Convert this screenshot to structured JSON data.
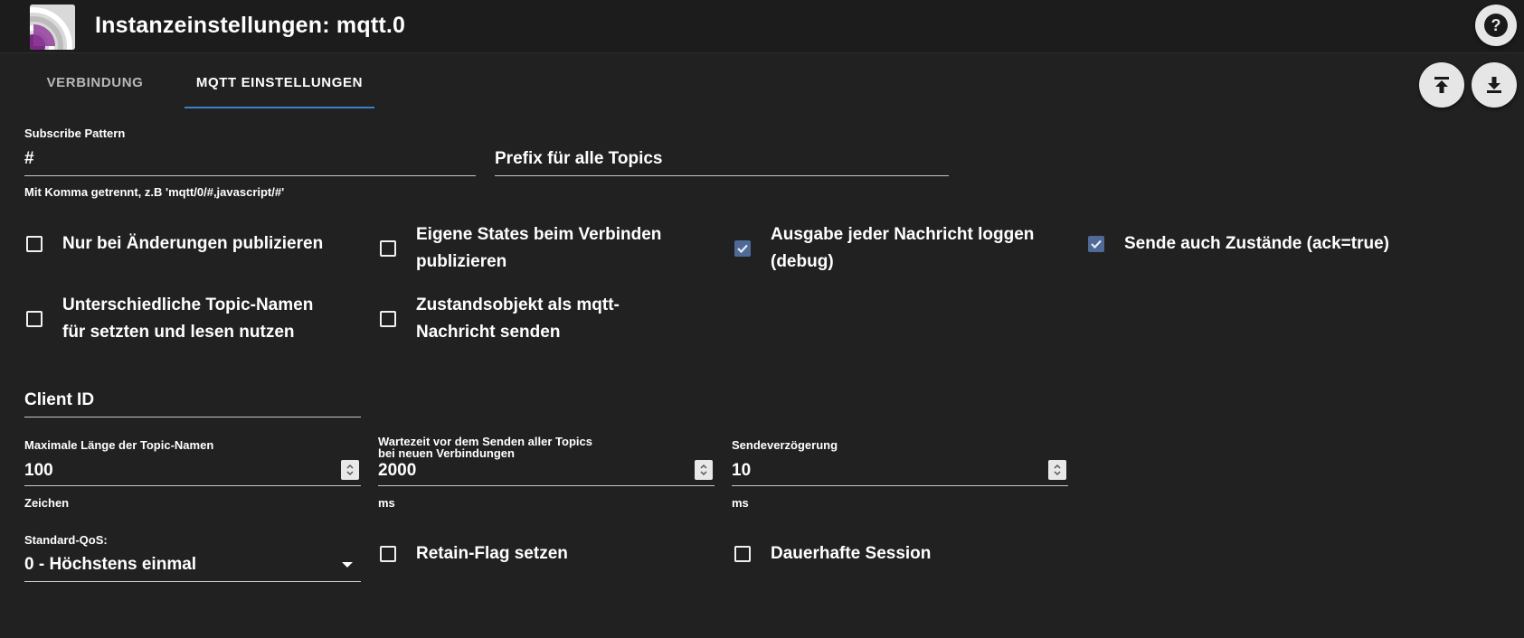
{
  "header": {
    "title": "Instanzeinstellungen: mqtt.0"
  },
  "icons": {
    "help": "help-circle-icon",
    "upload": "upload-icon",
    "download": "download-icon",
    "logo": "mqtt-logo-icon"
  },
  "colors": {
    "background": "#212121",
    "accent": "#3f7fc6",
    "checkbox_checked": "#4f6a96"
  },
  "tabs": [
    {
      "label": "VERBINDUNG",
      "active": false
    },
    {
      "label": "MQTT EINSTELLUNGEN",
      "active": true
    }
  ],
  "form": {
    "subscribe": {
      "label": "Subscribe Pattern",
      "value": "#",
      "helper": "Mit Komma getrennt, z.B 'mqtt/0/#,javascript/#'"
    },
    "prefix": {
      "placeholder": "Prefix für alle Topics"
    },
    "checkboxes": [
      {
        "label_lines": [
          "Nur bei Änderungen publizieren"
        ],
        "checked": false
      },
      {
        "label_lines": [
          "Eigene States beim Verbinden",
          "publizieren"
        ],
        "checked": false
      },
      {
        "label_lines": [
          "Ausgabe jeder Nachricht loggen",
          "(debug)"
        ],
        "checked": true
      },
      {
        "label_lines": [
          "Sende auch Zustände (ack=true)"
        ],
        "checked": true
      },
      {
        "label_lines": [
          "Unterschiedliche Topic-Namen",
          "für setzten und lesen nutzen"
        ],
        "checked": false
      },
      {
        "label_lines": [
          "Zustandsobjekt als mqtt-",
          "Nachricht senden"
        ],
        "checked": false
      }
    ],
    "client_id": {
      "placeholder": "Client ID"
    },
    "max_topic_length": {
      "label": "Maximale Länge der Topic-Namen",
      "value": "100",
      "helper": "Zeichen"
    },
    "wait_before_send": {
      "label_lines": [
        "Wartezeit vor dem Senden aller Topics",
        "bei neuen Verbindungen"
      ],
      "value": "2000",
      "helper": "ms"
    },
    "send_delay": {
      "label": "Sendeverzögerung",
      "value": "10",
      "helper": "ms"
    },
    "qos": {
      "label": "Standard-QoS:",
      "value": "0 - Höchstens einmal"
    },
    "retain": {
      "label": "Retain-Flag setzen",
      "checked": false
    },
    "persistent": {
      "label": "Dauerhafte Session",
      "checked": false
    }
  }
}
